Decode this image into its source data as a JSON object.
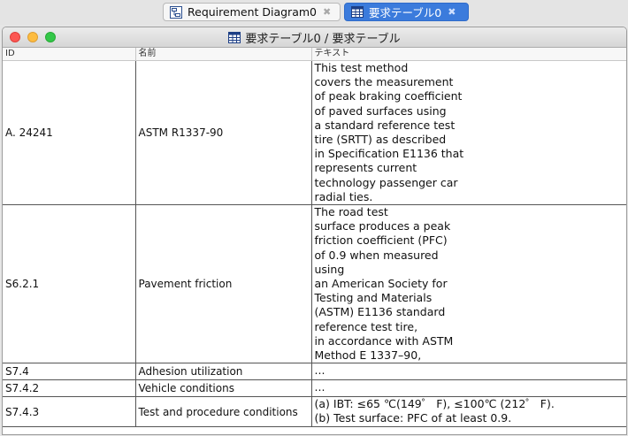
{
  "tabs": [
    {
      "label": "Requirement Diagram0",
      "icon": "diagram-icon",
      "active": false
    },
    {
      "label": "要求テーブル0",
      "icon": "table-icon",
      "active": true
    }
  ],
  "window": {
    "title": "要求テーブル0 / 要求テーブル"
  },
  "table": {
    "columns": [
      "ID",
      "名前",
      "テキスト"
    ],
    "rows": [
      {
        "id": "A. 24241",
        "name": "ASTM R1337-90",
        "text": "This test method\ncovers the measurement\nof peak braking coefficient\nof paved surfaces using\na standard reference test\ntire (SRTT) as described\nin Specification E1136 that\nrepresents current\ntechnology passenger car\nradial ties."
      },
      {
        "id": "S6.2.1",
        "name": "Pavement friction",
        "text": "The road test\nsurface produces a peak\nfriction coefficient (PFC)\nof 0.9 when measured\nusing\nan American Society for\nTesting and Materials\n(ASTM) E1136 standard\nreference test tire,\nin accordance with ASTM\nMethod E 1337–90,"
      },
      {
        "id": "S7.4",
        "name": "Adhesion utilization",
        "text": "..."
      },
      {
        "id": "S7.4.2",
        "name": "Vehicle conditions",
        "text": "..."
      },
      {
        "id": "S7.4.3",
        "name": "Test and procedure conditions",
        "text": "(a) IBT: ≤65 ℃(149゜ F), ≤100℃ (212゜ F).\n(b) Test surface: PFC of at least 0.9."
      }
    ]
  },
  "colors": {
    "active_tab": "#3b7bdc",
    "close_red": "#fc5753",
    "minimize_yellow": "#fdbc40",
    "zoom_green": "#33c748"
  }
}
